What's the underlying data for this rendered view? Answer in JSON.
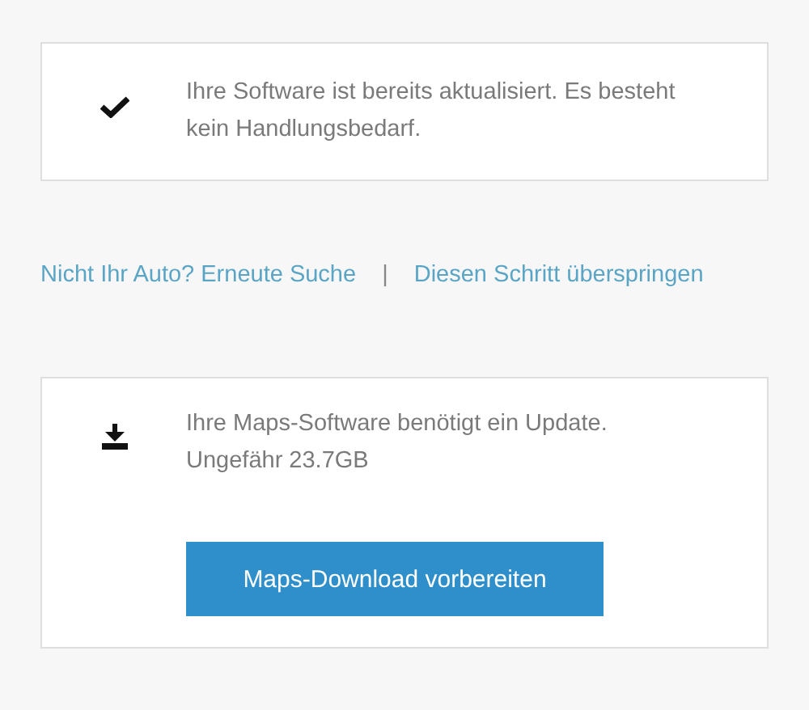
{
  "status_card": {
    "message": "Ihre Software ist bereits aktualisiert. Es besteht kein Handlungsbedarf."
  },
  "links": [
    {
      "label": "Nicht Ihr Auto? Erneute Suche"
    },
    {
      "label": "Diesen Schritt überspringen"
    }
  ],
  "link_separator": "|",
  "update_card": {
    "message": "Ihre Maps-Software benötigt ein Update.",
    "size": "Ungefähr 23.7GB",
    "button": "Maps-Download vorbereiten"
  }
}
